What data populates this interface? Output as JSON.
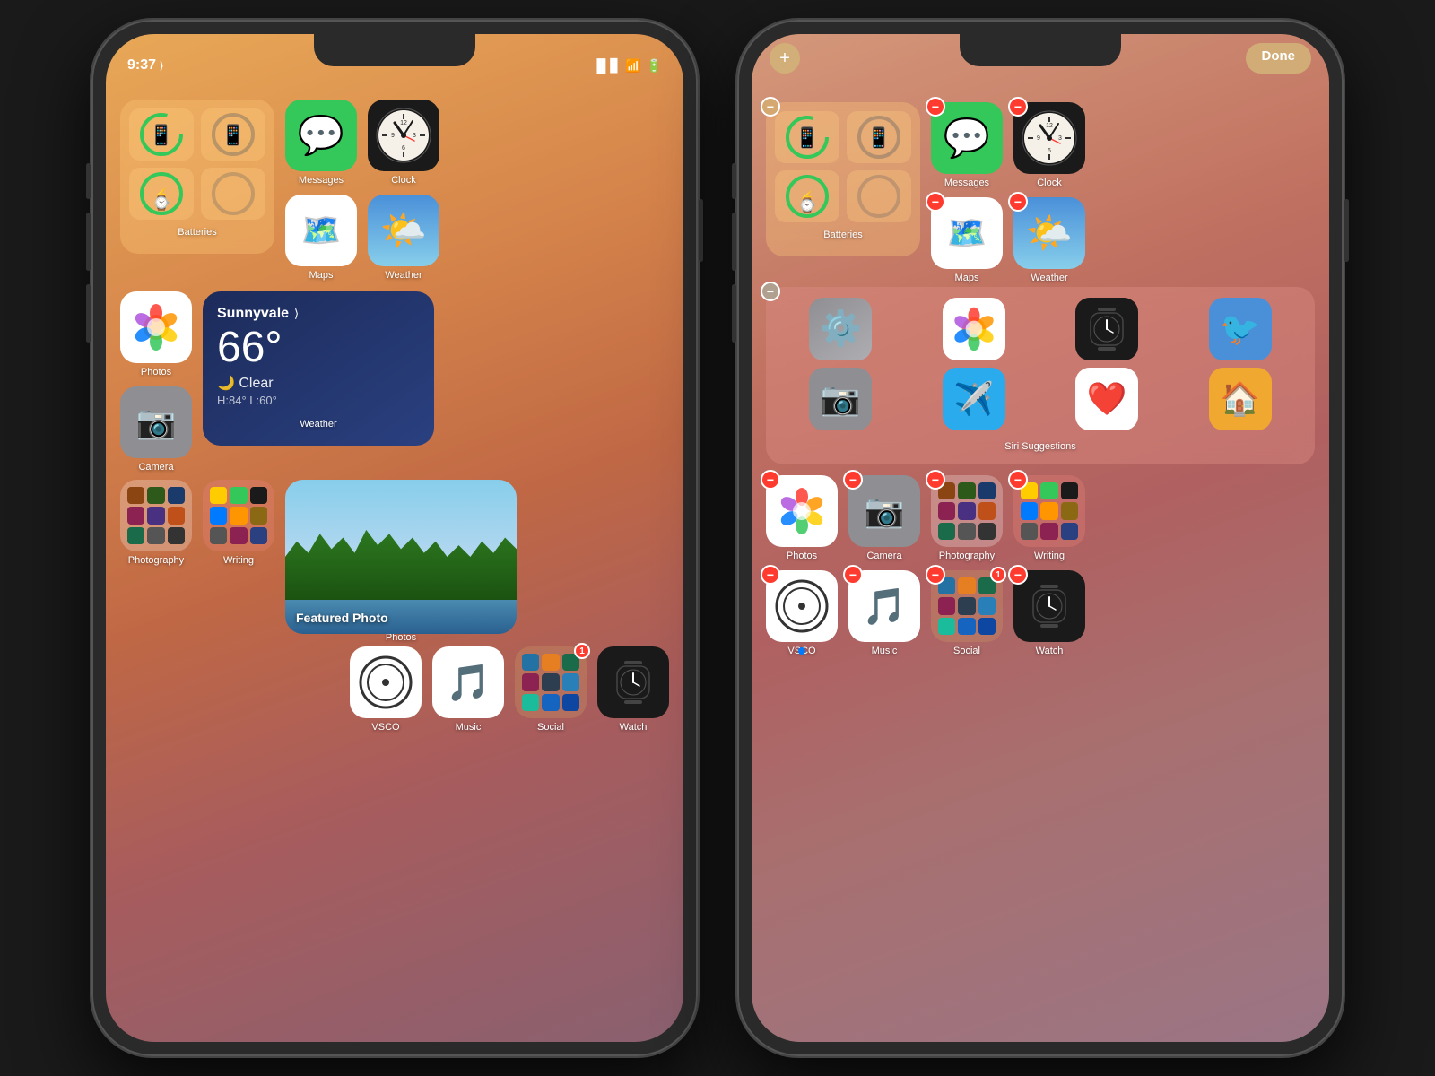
{
  "phone_left": {
    "status_bar": {
      "time": "9:37",
      "location_icon": "◂",
      "signal": "▐▐▐",
      "wifi": "wifi",
      "battery": "battery"
    },
    "rows": [
      {
        "type": "widget_row",
        "items": [
          {
            "type": "batteries_widget",
            "label": "Batteries"
          },
          {
            "type": "app",
            "name": "Messages",
            "color": "#34c759",
            "icon": "💬"
          },
          {
            "type": "app",
            "name": "Maps",
            "icon": "🗺️"
          }
        ]
      },
      {
        "type": "app_row",
        "items": [
          {
            "type": "clock",
            "name": "Clock"
          },
          {
            "type": "weather_app",
            "name": "Weather",
            "icon": "🌤️"
          }
        ]
      },
      {
        "type": "mixed_row",
        "items": [
          {
            "type": "photos",
            "name": "Photos"
          },
          {
            "type": "camera",
            "name": "Camera"
          },
          {
            "type": "weather_widget",
            "city": "Sunnyvale",
            "temp": "66°",
            "condition": "Clear",
            "hi": "H:84°",
            "lo": "L:60°",
            "label": "Weather"
          }
        ]
      },
      {
        "type": "mixed_row2",
        "items": [
          {
            "type": "folder",
            "name": "Photography"
          },
          {
            "type": "folder",
            "name": "Writing"
          },
          {
            "type": "photo_widget",
            "label": "Featured Photo",
            "sublabel": "Photos"
          }
        ]
      },
      {
        "type": "app_row2",
        "items": [
          {
            "type": "vsco",
            "name": "VSCO"
          },
          {
            "type": "music",
            "name": "Music"
          },
          {
            "type": "folder_social",
            "name": "Social",
            "badge": "1"
          },
          {
            "type": "watch",
            "name": "Watch"
          }
        ]
      }
    ]
  },
  "phone_right": {
    "edit_mode": true,
    "buttons": {
      "plus": "+",
      "done": "Done"
    },
    "siri_suggestions_label": "Siri Suggestions",
    "apps": {
      "messages": "Messages",
      "maps": "Maps",
      "batteries": "Batteries",
      "clock": "Clock",
      "weather": "Weather",
      "photos": "Photos",
      "camera": "Camera",
      "photography": "Photography",
      "writing": "Writing",
      "vsco": "VSCO",
      "music": "Music",
      "social": "Social",
      "watch": "Watch"
    }
  }
}
